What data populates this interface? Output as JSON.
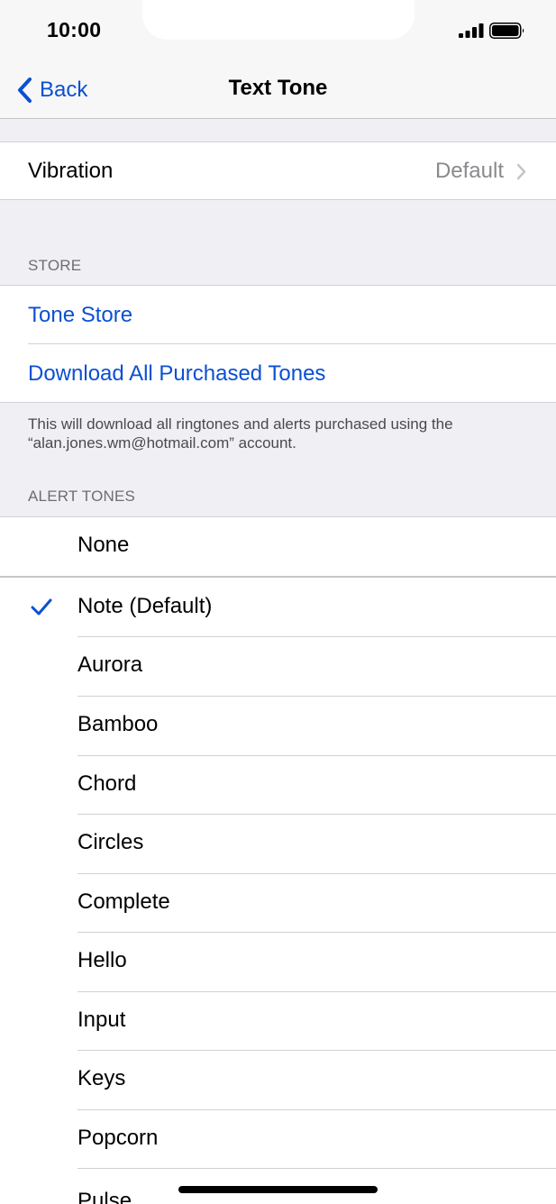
{
  "status_bar": {
    "time": "10:00"
  },
  "nav": {
    "back_label": "Back",
    "title": "Text Tone"
  },
  "vibration": {
    "label": "Vibration",
    "value": "Default"
  },
  "store": {
    "header": "STORE",
    "tone_store": "Tone Store",
    "download_all": "Download All Purchased Tones",
    "footer": "This will download all ringtones and alerts purchased using the “alan.jones.wm@hotmail.com” account."
  },
  "alert_tones": {
    "header": "ALERT TONES",
    "none": "None",
    "selected": "Note (Default)",
    "items": [
      "Note (Default)",
      "Aurora",
      "Bamboo",
      "Chord",
      "Circles",
      "Complete",
      "Hello",
      "Input",
      "Keys",
      "Popcorn",
      "Pulse"
    ]
  },
  "colors": {
    "accent": "#0a50d0",
    "grouped_background": "#efeff4",
    "secondary_text": "#8a8a8e"
  }
}
